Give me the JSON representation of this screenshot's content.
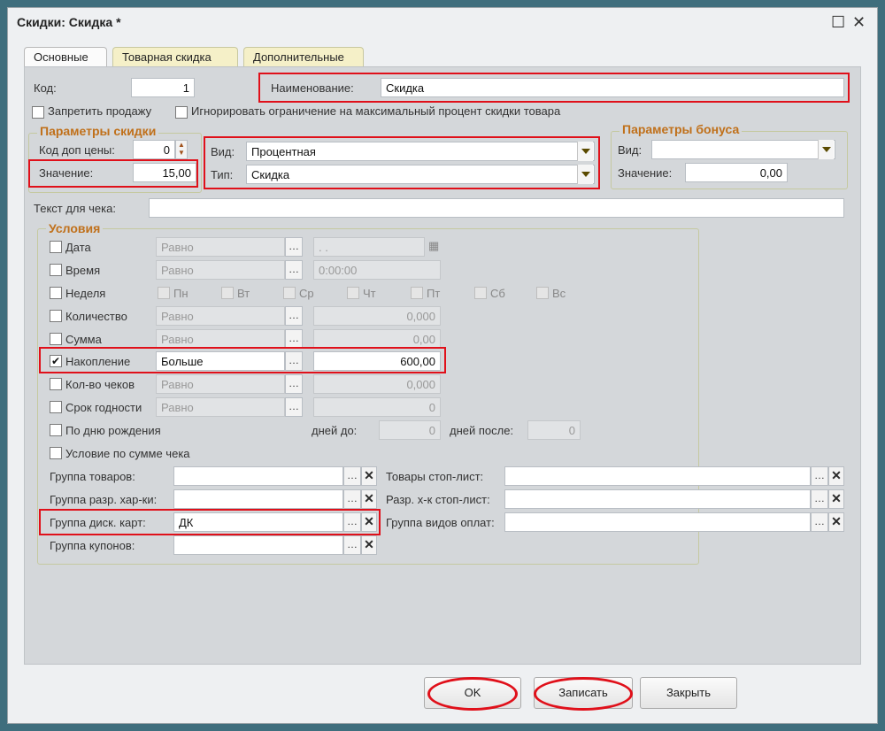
{
  "window": {
    "title": "Скидки: Скидка *"
  },
  "tabs": [
    "Основные",
    "Товарная скидка",
    "Дополнительные"
  ],
  "top": {
    "kod_label": "Код:",
    "kod_value": "1",
    "name_label": "Наименование:",
    "name_value": "Скидка",
    "forbid_sale": "Запретить продажу",
    "ignore_limit": "Игнорировать ограничение на максимальный процент скидки товара"
  },
  "discount_params": {
    "title": "Параметры скидки",
    "price_code_label": "Код доп цены:",
    "price_code_value": "0",
    "value_label": "Значение:",
    "value": "15,00",
    "vid_label": "Вид:",
    "vid_value": "Процентная",
    "tip_label": "Тип:",
    "tip_value": "Скидка"
  },
  "bonus_params": {
    "title": "Параметры бонуса",
    "vid_label": "Вид:",
    "vid_value": "",
    "value_label": "Значение:",
    "value": "0,00"
  },
  "receipt_text_label": "Текст для чека:",
  "conditions": {
    "title": "Условия",
    "date": {
      "label": "Дата",
      "op": "Равно",
      "value": ". ."
    },
    "time": {
      "label": "Время",
      "op": "Равно",
      "value": "0:00:00"
    },
    "week": {
      "label": "Неделя",
      "days": [
        "Пн",
        "Вт",
        "Ср",
        "Чт",
        "Пт",
        "Сб",
        "Вс"
      ]
    },
    "quantity": {
      "label": "Количество",
      "op": "Равно",
      "value": "0,000"
    },
    "sum": {
      "label": "Сумма",
      "op": "Равно",
      "value": "0,00"
    },
    "accumulation": {
      "label": "Накопление",
      "op": "Больше",
      "value": "600,00",
      "checked": true
    },
    "checks_count": {
      "label": "Кол-во чеков",
      "op": "Равно",
      "value": "0,000"
    },
    "expiry": {
      "label": "Срок годности",
      "op": "Равно",
      "value": "0"
    },
    "birthday": {
      "label": "По дню рождения",
      "before_label": "дней до:",
      "before_value": "0",
      "after_label": "дней после:",
      "after_value": "0"
    },
    "receipt_sum": {
      "label": "Условие по сумме чека"
    }
  },
  "groups": {
    "goods_group": "Группа товаров:",
    "char_group": "Группа разр. хар-ки:",
    "card_group": "Группа диск. карт:",
    "card_group_value": "ДК",
    "coupon_group": "Группа купонов:",
    "stop_goods": "Товары стоп-лист:",
    "stop_char": "Разр. х-к стоп-лист:",
    "payment_group": "Группа видов оплат:"
  },
  "buttons": {
    "ok": "OK",
    "write": "Записать",
    "close": "Закрыть"
  }
}
